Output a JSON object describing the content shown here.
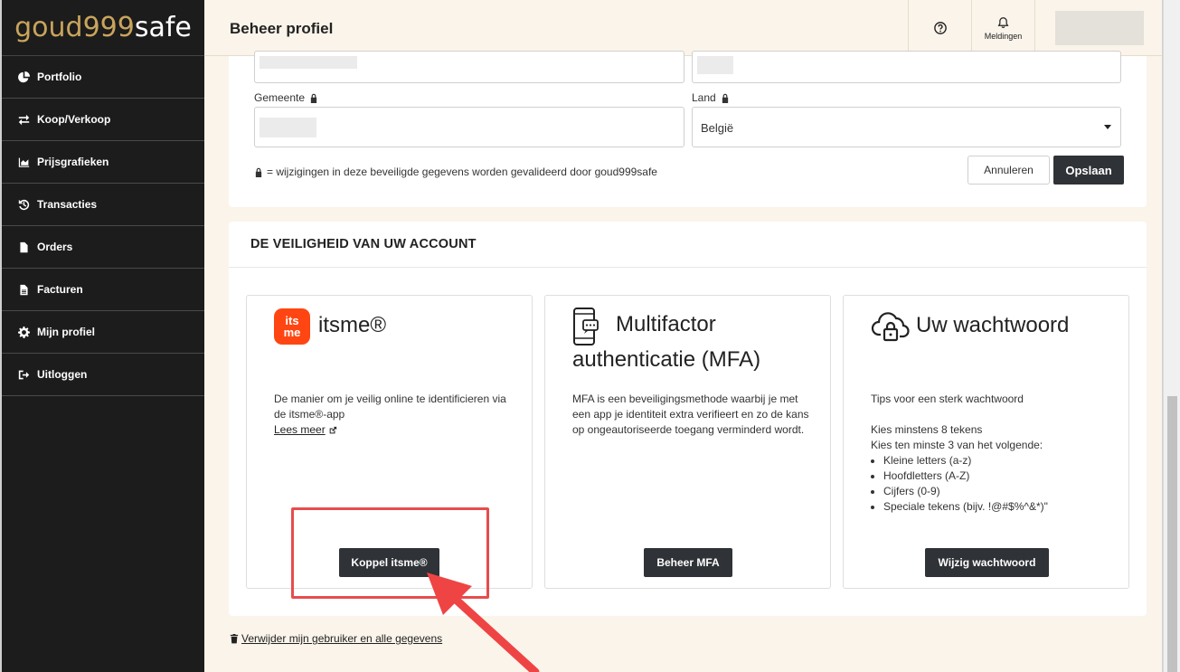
{
  "brand": {
    "part1": "goud999",
    "part2": "safe"
  },
  "sidebar": {
    "items": [
      {
        "label": "Portfolio",
        "icon": "pie-chart-icon"
      },
      {
        "label": "Koop/Verkoop",
        "icon": "exchange-icon"
      },
      {
        "label": "Prijsgrafieken",
        "icon": "area-chart-icon"
      },
      {
        "label": "Transacties",
        "icon": "history-icon"
      },
      {
        "label": "Orders",
        "icon": "file-icon"
      },
      {
        "label": "Facturen",
        "icon": "file-text-icon"
      },
      {
        "label": "Mijn profiel",
        "icon": "gear-icon"
      },
      {
        "label": "Uitloggen",
        "icon": "sign-out-icon"
      }
    ]
  },
  "header": {
    "title": "Beheer profiel",
    "notifications_label": "Meldingen"
  },
  "form": {
    "gemeente_label": "Gemeente",
    "land_label": "Land",
    "land_value": "België",
    "note": "= wijzigingen in deze beveiligde gegevens worden gevalideerd door goud999safe",
    "cancel_label": "Annuleren",
    "save_label": "Opslaan"
  },
  "security": {
    "title": "DE VEILIGHEID VAN UW ACCOUNT",
    "itsme": {
      "logo_top": "its",
      "logo_bottom": "me",
      "title": "itsme®",
      "description": "De manier om je veilig online te identificieren via de itsme®-app",
      "link_label": "Lees meer",
      "button_label": "Koppel itsme®"
    },
    "mfa": {
      "title": "Multifactor authenticatie (MFA)",
      "description": "MFA is een beveiligingsmethode waarbij je met een app je identiteit extra verifieert en zo de kans op ongeautoriseerde toegang verminderd wordt.",
      "button_label": "Beheer MFA"
    },
    "password": {
      "title": "Uw wachtwoord",
      "intro": "Tips voor een sterk wachtwoord",
      "min_length": "Kies minstens 8 tekens",
      "rule_intro": "Kies ten minste 3 van het volgende:",
      "rules": [
        "Kleine letters (a-z)",
        "Hoofdletters (A-Z)",
        "Cijfers (0-9)",
        "Speciale tekens (bijv. !@#$%^&*)\""
      ],
      "button_label": "Wijzig wachtwoord"
    }
  },
  "delete_link": "Verwijder mijn gebruiker en alle gegevens",
  "colors": {
    "sidebar_bg": "#1c1c1c",
    "accent_gold": "#c9a45c",
    "page_bg": "#faf4ea",
    "button_dark": "#2f3236",
    "itsme_orange": "#ff4612",
    "annotation_red": "#e74c4c"
  }
}
